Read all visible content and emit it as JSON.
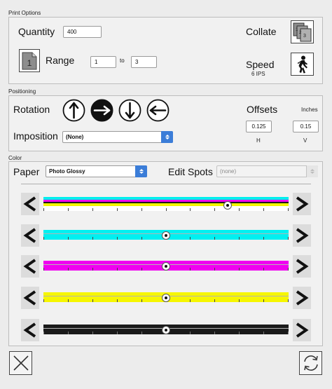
{
  "print_options": {
    "section_label": "Print Options",
    "quantity_label": "Quantity",
    "quantity_value": "400",
    "range_icon_text": "1",
    "range_label": "Range",
    "range_from": "1",
    "range_to_label": "to",
    "range_to": "3",
    "collate_label": "Collate",
    "collate_icon": "collate-pages-icon",
    "speed_label": "Speed",
    "speed_value": "6 IPS",
    "speed_icon": "walking-person-icon"
  },
  "positioning": {
    "section_label": "Positioning",
    "rotation_label": "Rotation",
    "rotation_options": [
      "up",
      "right",
      "down",
      "left"
    ],
    "rotation_selected": "right",
    "imposition_label": "Imposition",
    "imposition_value": "(None)",
    "offsets_label": "Offsets",
    "offsets_unit": "Inches",
    "offset_h_value": "0.125",
    "offset_h_label": "H",
    "offset_v_value": "0.15",
    "offset_v_label": "V"
  },
  "color": {
    "section_label": "Color",
    "paper_label": "Paper",
    "paper_value": "Photo Glossy",
    "edit_spots_label": "Edit Spots",
    "edit_spots_value": "(none)",
    "sliders": [
      {
        "channel": "all",
        "position": 0.75
      },
      {
        "channel": "cyan",
        "color": "#00f0f0",
        "position": 0.5
      },
      {
        "channel": "magenta",
        "color": "#f000f0",
        "position": 0.5
      },
      {
        "channel": "yellow",
        "color": "#f6f600",
        "position": 0.5
      },
      {
        "channel": "black",
        "color": "#1a1a1a",
        "position": 0.5
      }
    ]
  },
  "footer": {
    "cancel_icon": "close-x-icon",
    "refresh_icon": "refresh-icon"
  }
}
